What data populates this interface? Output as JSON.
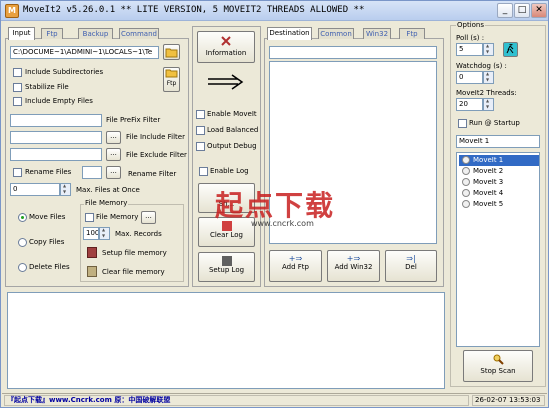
{
  "window": {
    "title": "MoveIt2 v5.26.0.1 ** LITE VERSION, 5 MOVEIT2 THREADS ALLOWED **"
  },
  "left_tabs": [
    "Input",
    "Ftp",
    "Backup",
    "Command"
  ],
  "input": {
    "path": "C:\\DOCUME~1\\ADMINI~1\\LOCALS~1\\Te",
    "ftp_label": "Ftp",
    "include_subdirectories": "Include Subdirectories",
    "stabilize_file": "Stabilize File",
    "include_empty_files": "Include Empty Files",
    "file_prefix_filter": "File PreFix Filter",
    "file_include_filter": "File Include Filter",
    "file_exclude_filter": "File Exclude Filter",
    "rename_files": "Rename Files",
    "rename_filter": "Rename Filter",
    "max_files_value": "0",
    "max_files_label": "Max. Files at Once",
    "ellipsis": "..."
  },
  "actions": {
    "move_files": "Move Files",
    "copy_files": "Copy Files",
    "delete_files": "Delete Files"
  },
  "file_memory": {
    "group_label": "File Memory",
    "checkbox_label": "File Memory",
    "max_records_value": "100",
    "max_records_label": "Max. Records",
    "setup_label": "Setup file memory",
    "clear_label": "Clear file memory"
  },
  "middle": {
    "information": "Information",
    "enable_moveit": "Enable MoveIt",
    "load_balanced": "Load Balanced",
    "output_debug": "Output Debug",
    "enable_log": "Enable Log",
    "show_log": "Sh...",
    "clear_log": "Clear Log",
    "setup_log": "Setup Log"
  },
  "dest_tabs": [
    "Destination",
    "Common",
    "Win32",
    "Ftp"
  ],
  "dest_buttons": {
    "add_ftp": "Add Ftp",
    "add_win32": "Add Win32",
    "del": "Del"
  },
  "options": {
    "group_label": "Options",
    "poll_label": "Poll (s) :",
    "poll_value": "5",
    "watchdog_label": "Watchdog (s) :",
    "watchdog_value": "0",
    "threads_label": "MoveIt2 Threads:",
    "threads_value": "20",
    "run_at_startup": "Run @ Startup",
    "name_value": "MoveIt 1",
    "threads_list": [
      "MoveIt 1",
      "MoveIt 2",
      "MoveIt 3",
      "MoveIt 4",
      "MoveIt 5"
    ],
    "stop_scan": "Stop Scan"
  },
  "status": {
    "left": "『起点下载』www.Cncrk.com 原：中国破解联盟",
    "right": "26-02-07 13:53:03"
  },
  "watermark": {
    "main": "起点下载",
    "sub": "www.cncrk.com"
  },
  "colors": {
    "title_gradient": "#b9cdee",
    "selection": "#316ac5",
    "watermark": "#c82020"
  }
}
